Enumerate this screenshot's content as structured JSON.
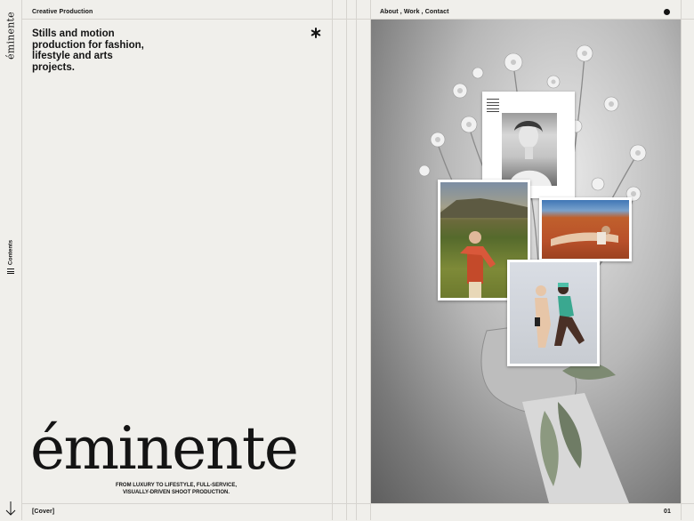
{
  "brand": {
    "sidebar_name": "éminente",
    "wordmark": "éminente"
  },
  "sidebar": {
    "contents_label": "Contents"
  },
  "header": {
    "left_title": "Creative Production",
    "nav": "About , Work , Contact"
  },
  "hero": {
    "tagline": "Stills and motion production for fashion, lifestyle and arts projects."
  },
  "subcopy": {
    "line1": "FROM LUXURY TO LIFESTYLE, FULL-SERVICE,",
    "line2": "VISUALLY-DRIVEN SHOOT PRODUCTION."
  },
  "footer": {
    "left_label": "[Cover]",
    "page_number": "01"
  },
  "icons": {
    "brand_mark": "asterisk-icon",
    "contents": "menu-icon",
    "scroll": "arrow-down-icon",
    "status": "dot-icon"
  },
  "colors": {
    "background": "#f0efeb",
    "text": "#141414",
    "rule": "#d6d4cf"
  }
}
